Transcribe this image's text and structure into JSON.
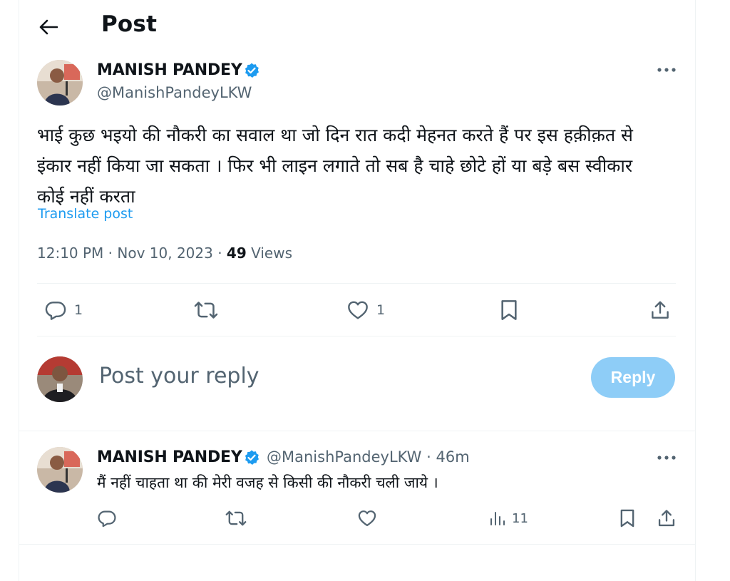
{
  "header": {
    "title": "Post"
  },
  "post": {
    "author_name": "MANISH PANDEY",
    "handle": "@ManishPandeyLKW",
    "text": "भाई कुछ भइयो की नौकरी का सवाल था जो दिन रात कदी मेहनत करते हैं पर इस हक़ीक़त से इंकार नहीं किया जा सकता । फिर भी लाइन लगाते तो सब है चाहे छोटे हों या बड़े बस स्वीकार कोई नहीं करता",
    "translate_label": "Translate post",
    "timestamp": "12:10 PM · Nov 10, 2023 · ",
    "views_count": "49",
    "views_label": " Views",
    "actions": {
      "reply_count": "1",
      "like_count": "1"
    }
  },
  "composer": {
    "placeholder": "Post your reply",
    "reply_button_label": "Reply"
  },
  "reply": {
    "author_name": "MANISH PANDEY",
    "handle_time": "@ManishPandeyLKW · 46m",
    "text": "मैं नहीं चाहता था की मेरी वजह से किसी की नौकरी चली जाये ।",
    "views_count": "11"
  },
  "colors": {
    "accent": "#1d9bf0",
    "reply_button_disabled": "#8ecdf7",
    "muted_text": "#536471",
    "divider": "#eff3f4"
  },
  "icons": [
    "back-arrow-icon",
    "verified-badge-icon",
    "more-icon",
    "reply-icon",
    "repost-icon",
    "like-icon",
    "bookmark-icon",
    "share-icon",
    "views-icon"
  ]
}
